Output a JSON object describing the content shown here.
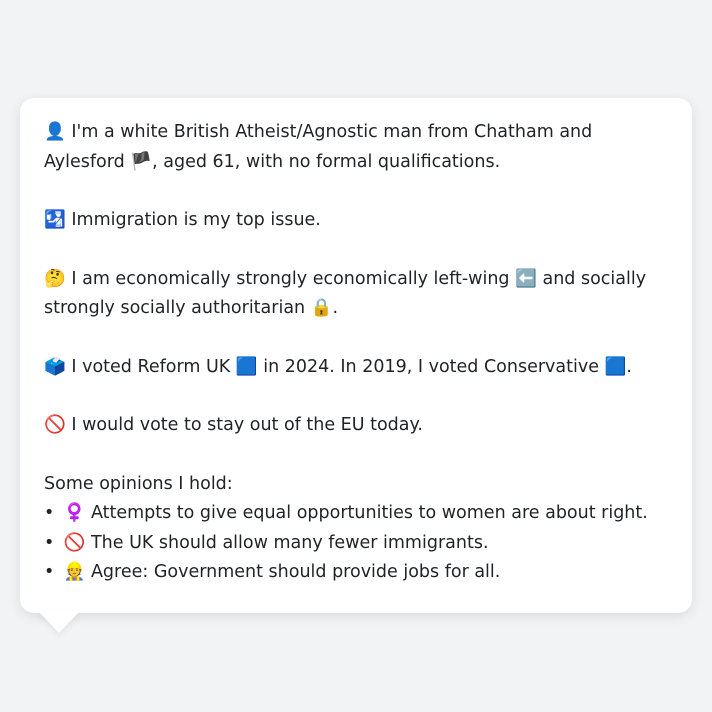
{
  "profile": {
    "identity": {
      "icon": "👤",
      "text": "I'm a white British Atheist/Agnostic man from Chatham and Aylesford",
      "flag": "🏴",
      "text2": ", aged 61, with no formal qualifications."
    },
    "issue": {
      "icon": "🛂",
      "text": "Immigration is my top issue."
    },
    "ideology": {
      "icon": "🤔",
      "text": "I am economically strongly economically left-wing",
      "left_icon": "⬅️",
      "text2": "and socially strongly socially authoritarian",
      "lock_icon": "🔒",
      "end": "."
    },
    "votes": {
      "icon": "🗳️",
      "text": "I voted Reform UK",
      "reform_icon": "🟦",
      "text2": "in 2024. In 2019, I voted Conservative",
      "cons_icon": "🟦",
      "end": "."
    },
    "eu": {
      "icon": "🚫",
      "text": "I would vote to stay out of the EU today."
    },
    "opinions_heading": "Some opinions I hold:",
    "opinions": [
      {
        "bullet": "•",
        "icon": "♀️",
        "text": "Attempts to give equal opportunities to women are about right."
      },
      {
        "bullet": "•",
        "icon": "🚫",
        "text": "The UK should allow many fewer immigrants."
      },
      {
        "bullet": "•",
        "icon": "👷",
        "text": "Agree: Government should provide jobs for all."
      }
    ]
  }
}
